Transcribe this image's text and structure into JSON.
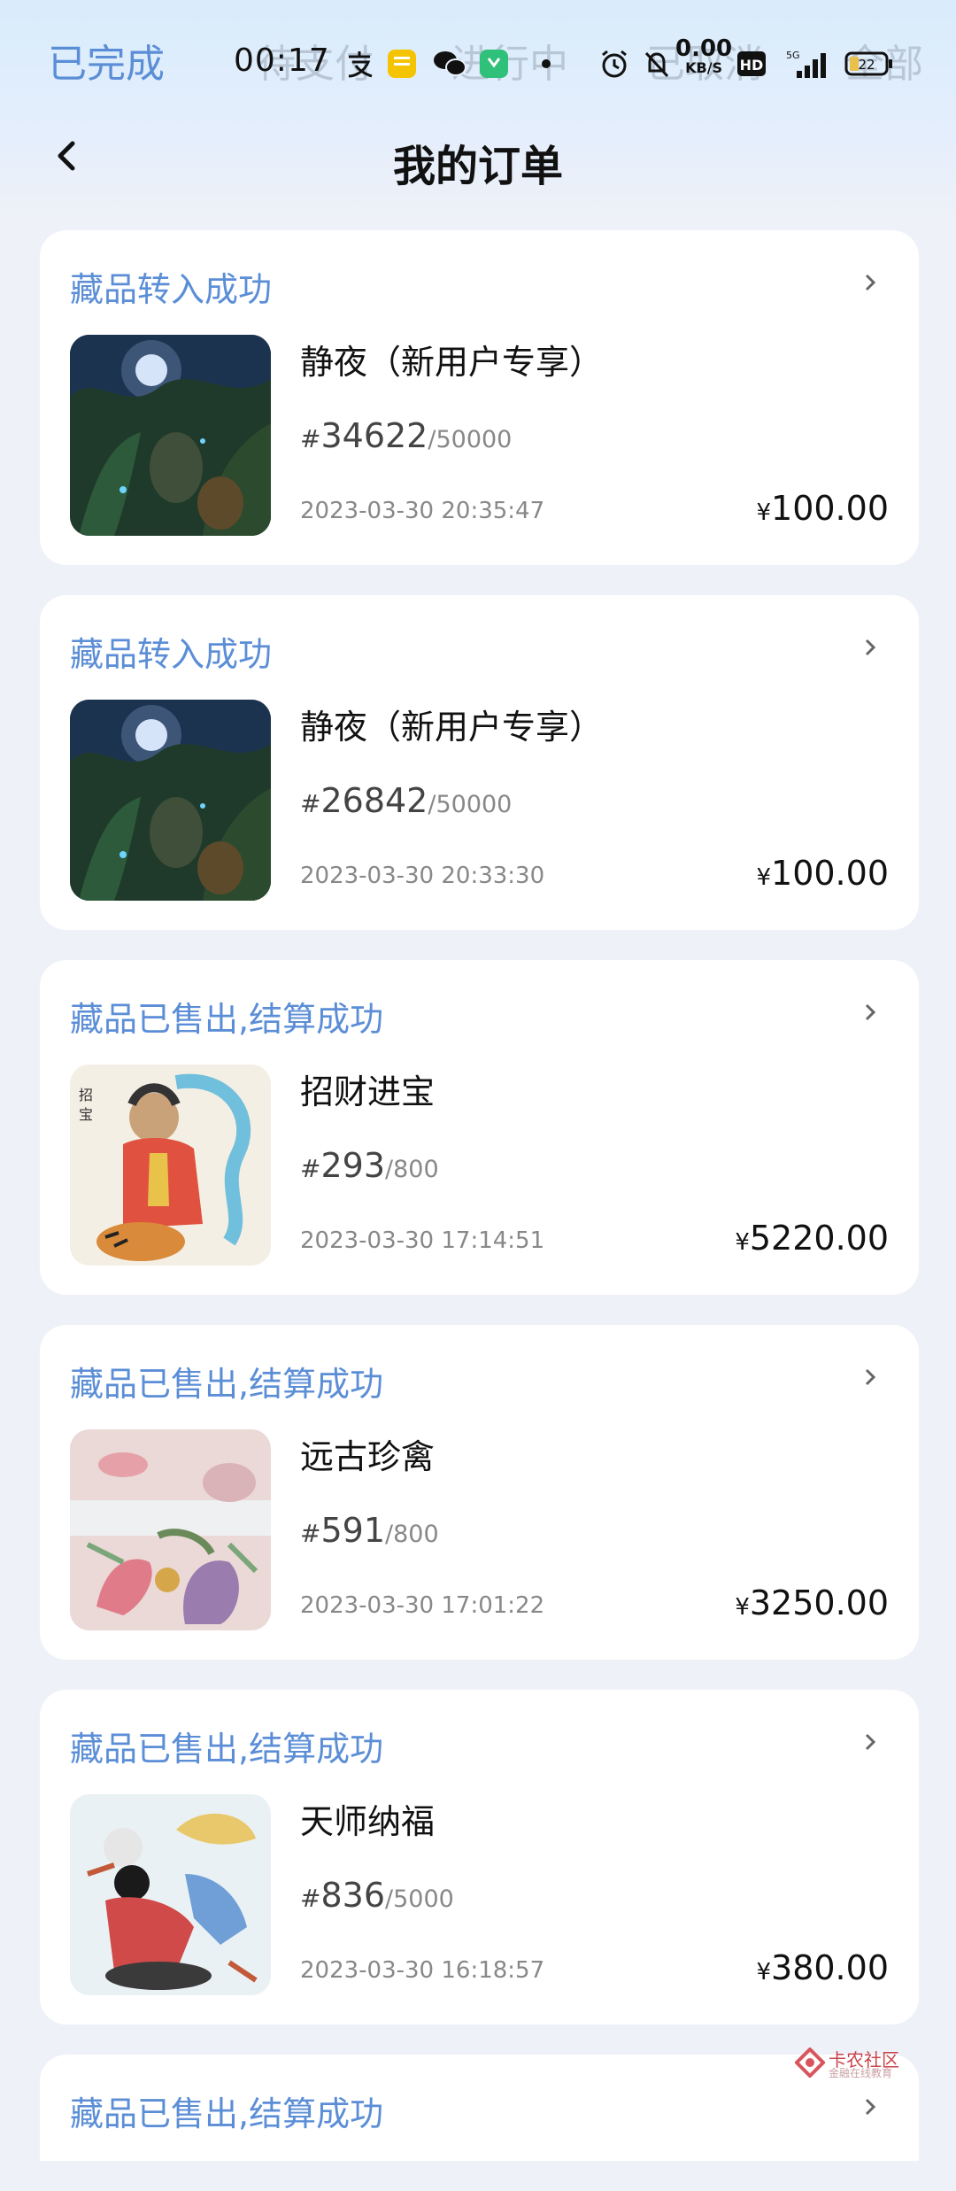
{
  "tabs": [
    "已完成",
    "待支付",
    "进行中",
    "已取消",
    "全部"
  ],
  "status_bar": {
    "time": "00:17",
    "net_speed_value": "0.00",
    "net_speed_unit": "KB/S",
    "battery": "22"
  },
  "header": {
    "title": "我的订单"
  },
  "orders": [
    {
      "status": "藏品转入成功",
      "name": "静夜（新用户专享）",
      "hash": "#",
      "serial": "34622",
      "total": "/50000",
      "time": "2023-03-30 20:35:47",
      "currency": "¥",
      "price": "100.00",
      "thumb": "night"
    },
    {
      "status": "藏品转入成功",
      "name": "静夜（新用户专享）",
      "hash": "#",
      "serial": "26842",
      "total": "/50000",
      "time": "2023-03-30 20:33:30",
      "currency": "¥",
      "price": "100.00",
      "thumb": "night"
    },
    {
      "status": "藏品已售出,结算成功",
      "name": "招财进宝",
      "hash": "#",
      "serial": "293",
      "total": "/800",
      "time": "2023-03-30 17:14:51",
      "currency": "¥",
      "price": "5220.00",
      "thumb": "god"
    },
    {
      "status": "藏品已售出,结算成功",
      "name": "远古珍禽",
      "hash": "#",
      "serial": "591",
      "total": "/800",
      "time": "2023-03-30 17:01:22",
      "currency": "¥",
      "price": "3250.00",
      "thumb": "birds"
    },
    {
      "status": "藏品已售出,结算成功",
      "name": "天师纳福",
      "hash": "#",
      "serial": "836",
      "total": "/5000",
      "time": "2023-03-30 16:18:57",
      "currency": "¥",
      "price": "380.00",
      "thumb": "master"
    }
  ],
  "partial_order": {
    "status": "藏品已售出,结算成功"
  },
  "watermark": {
    "text": "卡农社区",
    "subtext": "金融在线教育"
  },
  "colors": {
    "accent": "#5b8ed6",
    "background": "#eef1f7",
    "card": "#ffffff"
  }
}
